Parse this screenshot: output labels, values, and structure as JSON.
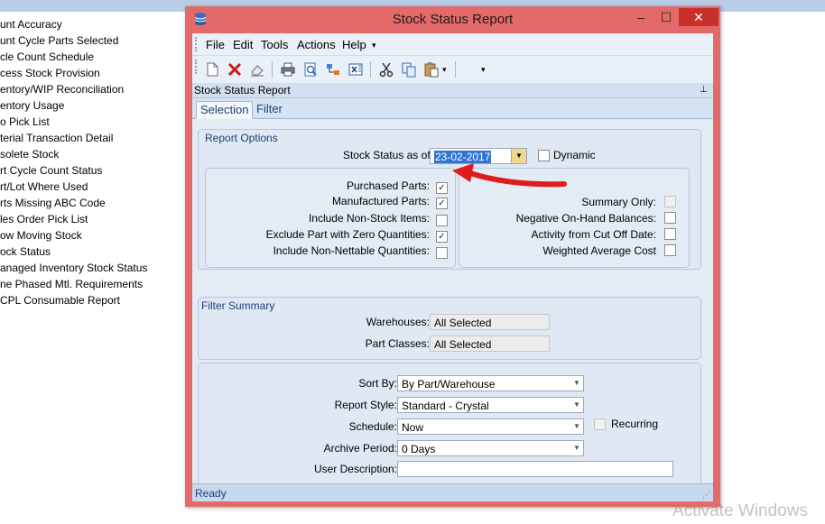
{
  "background_list": [
    "unt Accuracy",
    "unt Cycle Parts Selected",
    "cle Count Schedule",
    "cess Stock Provision",
    "entory/WIP Reconciliation",
    "entory Usage",
    "o Pick List",
    "terial Transaction Detail",
    "solete Stock",
    "rt Cycle Count Status",
    "rt/Lot Where Used",
    "rts Missing ABC Code",
    "les Order Pick List",
    "ow Moving Stock",
    "ock Status",
    "anaged Inventory Stock Status",
    "ne Phased Mtl. Requirements",
    "CPL Consumable Report"
  ],
  "watermark": "Activate Windows",
  "window": {
    "title": "Stock Status Report",
    "minimize": "–",
    "maximize": "☐",
    "close": "✕"
  },
  "menu": [
    "File",
    "Edit",
    "Tools",
    "Actions",
    "Help"
  ],
  "menu_more": "▾",
  "toolbar_more": "▾",
  "panel": {
    "title": "Stock Status Report",
    "pin": "⊥"
  },
  "tabs": [
    "Selection",
    "Filter"
  ],
  "report_options": {
    "label": "Report Options",
    "stock_status_label": "Stock Status as of:",
    "date_value": "23-02-2017",
    "dynamic_label": "Dynamic",
    "dynamic_checked": false,
    "left_checks": [
      {
        "label": "Purchased Parts:",
        "mark": "✓"
      },
      {
        "label": "Manufactured Parts:",
        "mark": "✓"
      },
      {
        "label": "Include Non-Stock Items:",
        "mark": ""
      },
      {
        "label": "Exclude Part with Zero Quantities:",
        "mark": "✓"
      },
      {
        "label": "Include Non-Nettable Quantities:",
        "mark": ""
      }
    ],
    "right_checks": [
      {
        "label": "Summary Only:",
        "mark": ""
      },
      {
        "label": "Negative On-Hand Balances:",
        "mark": ""
      },
      {
        "label": "Activity from Cut Off Date:",
        "mark": ""
      },
      {
        "label": "Weighted Average Cost",
        "mark": ""
      }
    ]
  },
  "filter_summary": {
    "label": "Filter Summary",
    "warehouses_label": "Warehouses:",
    "warehouses_value": "All Selected",
    "part_classes_label": "Part Classes:",
    "part_classes_value": "All Selected"
  },
  "output": {
    "sort_by_label": "Sort By:",
    "sort_by_value": "By Part/Warehouse",
    "report_style_label": "Report Style:",
    "report_style_value": "Standard - Crystal",
    "schedule_label": "Schedule:",
    "schedule_value": "Now",
    "recurring_label": "Recurring",
    "archive_label": "Archive Period:",
    "archive_value": "0 Days",
    "user_desc_label": "User Description:",
    "user_desc_value": ""
  },
  "status": "Ready",
  "colors": {
    "window_frame": "#e46a6a",
    "client": "#d6e3f2",
    "accent_text": "#1c3f78",
    "annotation_arrow": "#e01b1b"
  }
}
